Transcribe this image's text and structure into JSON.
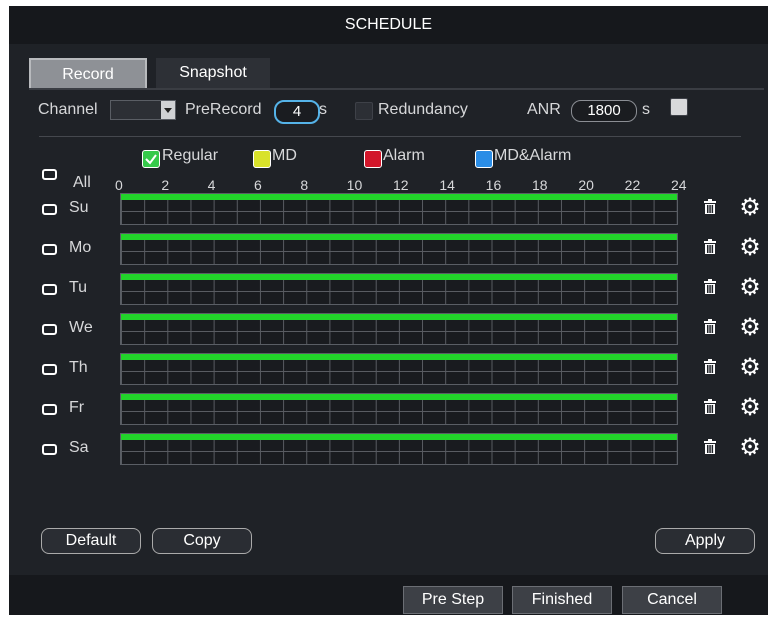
{
  "window": {
    "title": "SCHEDULE"
  },
  "tabs": [
    {
      "label": "Record"
    },
    {
      "label": "Snapshot"
    }
  ],
  "settings": {
    "channel_label": "Channel",
    "channel_value": "",
    "prerecord_label": "PreRecord",
    "prerecord_value": "4",
    "prerecord_unit": "s",
    "redundancy_label": "Redundancy",
    "anr_label": "ANR",
    "anr_value": "1800",
    "anr_unit": "s"
  },
  "legend": [
    {
      "label": "Regular",
      "color": "#35c94a"
    },
    {
      "label": "MD",
      "color": "#d9e22a"
    },
    {
      "label": "Alarm",
      "color": "#d2162a"
    },
    {
      "label": "MD&Alarm",
      "color": "#2a8de6"
    }
  ],
  "all_label": "All",
  "hours": [
    "0",
    "2",
    "4",
    "6",
    "8",
    "10",
    "12",
    "14",
    "16",
    "18",
    "20",
    "22",
    "24"
  ],
  "days": [
    {
      "label": "Su",
      "regular_from": 0,
      "regular_to": 24
    },
    {
      "label": "Mo",
      "regular_from": 0,
      "regular_to": 24
    },
    {
      "label": "Tu",
      "regular_from": 0,
      "regular_to": 24
    },
    {
      "label": "We",
      "regular_from": 0,
      "regular_to": 24
    },
    {
      "label": "Th",
      "regular_from": 0,
      "regular_to": 24
    },
    {
      "label": "Fr",
      "regular_from": 0,
      "regular_to": 24
    },
    {
      "label": "Sa",
      "regular_from": 0,
      "regular_to": 24
    }
  ],
  "buttons": {
    "default": "Default",
    "copy": "Copy",
    "apply": "Apply",
    "pre_step": "Pre Step",
    "finished": "Finished",
    "cancel": "Cancel"
  }
}
